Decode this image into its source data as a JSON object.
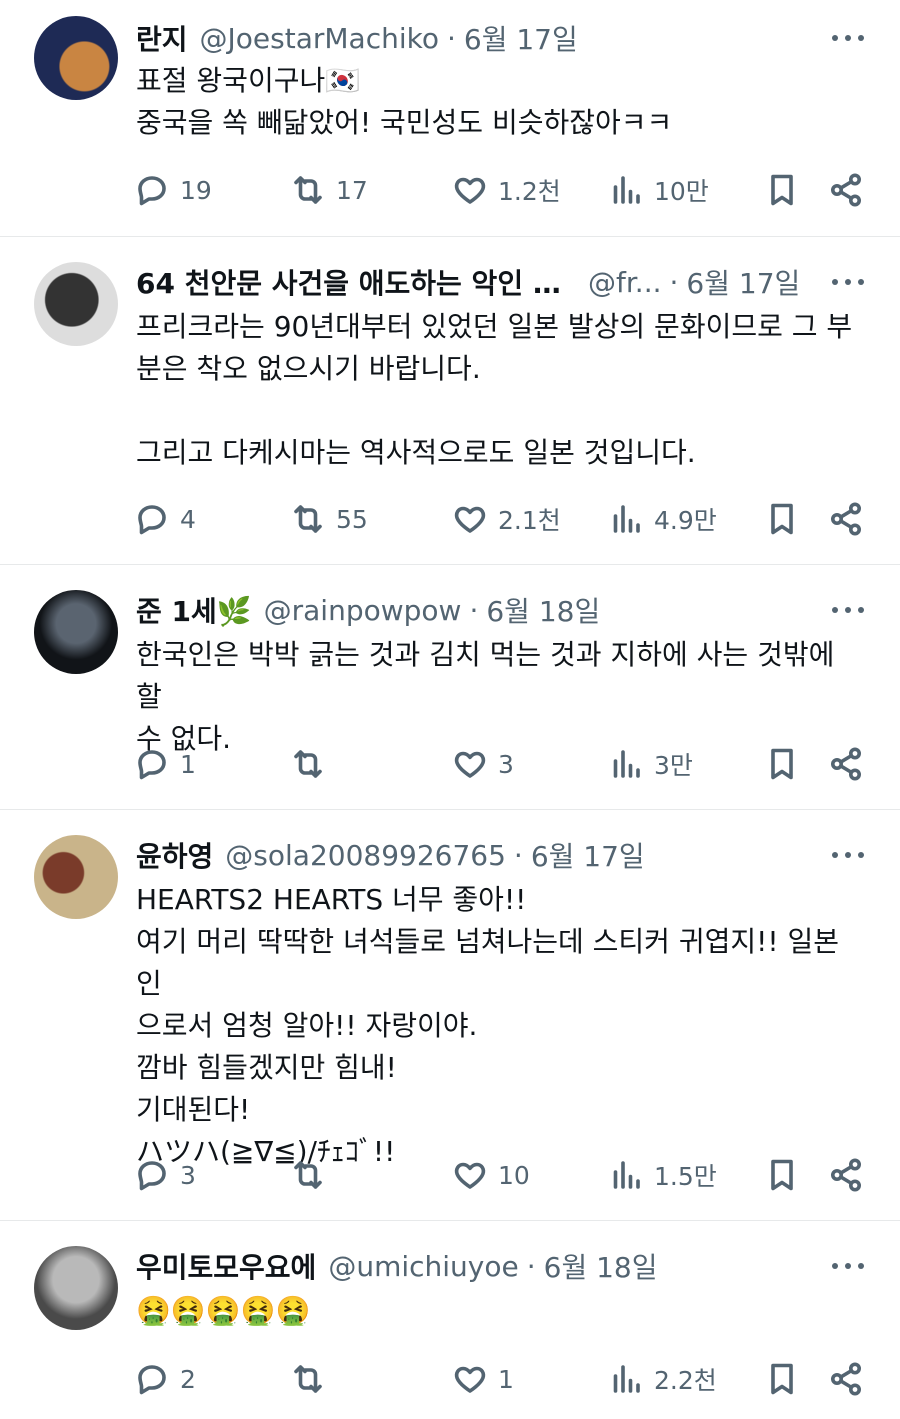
{
  "tweets": [
    {
      "name": "란지",
      "handle": "@JoestarMachiko",
      "date": "6월 17일",
      "lines": [
        "표절 왕국이구나🇰🇷",
        "중국을 쏙 빼닮았어! 국민성도 비슷하잖아ㅋㅋ"
      ],
      "replies": "19",
      "retweets": "17",
      "likes": "1.2천",
      "views": "10만",
      "avatar_colors": [
        "#1e2a55",
        "#c98542"
      ]
    },
    {
      "name": "64 천안문 사건을 애도하는 악인 얼...",
      "handle": "@fr...",
      "date": "6월 17일",
      "lines": [
        "프리크라는 90년대부터 있었던 일본 발상의 문화이므로 그 부",
        "분은 착오 없으시기 바랍니다.",
        "",
        "그리고 다케시마는 역사적으로도 일본 것입니다."
      ],
      "replies": "4",
      "retweets": "55",
      "likes": "2.1천",
      "views": "4.9만",
      "avatar_colors": [
        "#dddddd",
        "#333333"
      ]
    },
    {
      "name": "준 1세🌿",
      "handle": "@rainpowpow",
      "date": "6월 18일",
      "lines": [
        "한국인은 박박 긁는 것과 김치 먹는 것과 지하에 사는 것밖에 할",
        "수 없다."
      ],
      "replies": "1",
      "retweets": "",
      "likes": "3",
      "views": "3만",
      "avatar_colors": [
        "#5a6470",
        "#111418"
      ]
    },
    {
      "name": "윤하영",
      "handle": "@sola20089926765",
      "date": "6월 17일",
      "lines": [
        "HEARTS2 HEARTS 너무 좋아!!",
        "여기 머리 딱딱한 녀석들로 넘쳐나는데 스티커 귀엽지!! 일본인",
        "으로서 엄청 알아!! 자랑이야.",
        "깜바 힘들겠지만 힘내!",
        "기대된다!",
        "ハツハ(≧∇≦)/ﾁｪｺﾞ!!"
      ],
      "replies": "3",
      "retweets": "",
      "likes": "10",
      "views": "1.5만",
      "avatar_colors": [
        "#c9b48a",
        "#7a3b2a"
      ]
    },
    {
      "name": "우미토모우요에",
      "handle": "@umichiuyoe",
      "date": "6월 18일",
      "lines": [
        "🤮🤮🤮🤮🤮"
      ],
      "replies": "2",
      "retweets": "",
      "likes": "1",
      "views": "2.2천",
      "avatar_colors": [
        "#b9b9b9",
        "#4a4a4a"
      ]
    }
  ],
  "icons": {
    "reply": "reply-icon",
    "retweet": "retweet-icon",
    "like": "heart-icon",
    "views": "views-icon",
    "bookmark": "bookmark-icon",
    "share": "share-icon",
    "more": "more-icon"
  }
}
